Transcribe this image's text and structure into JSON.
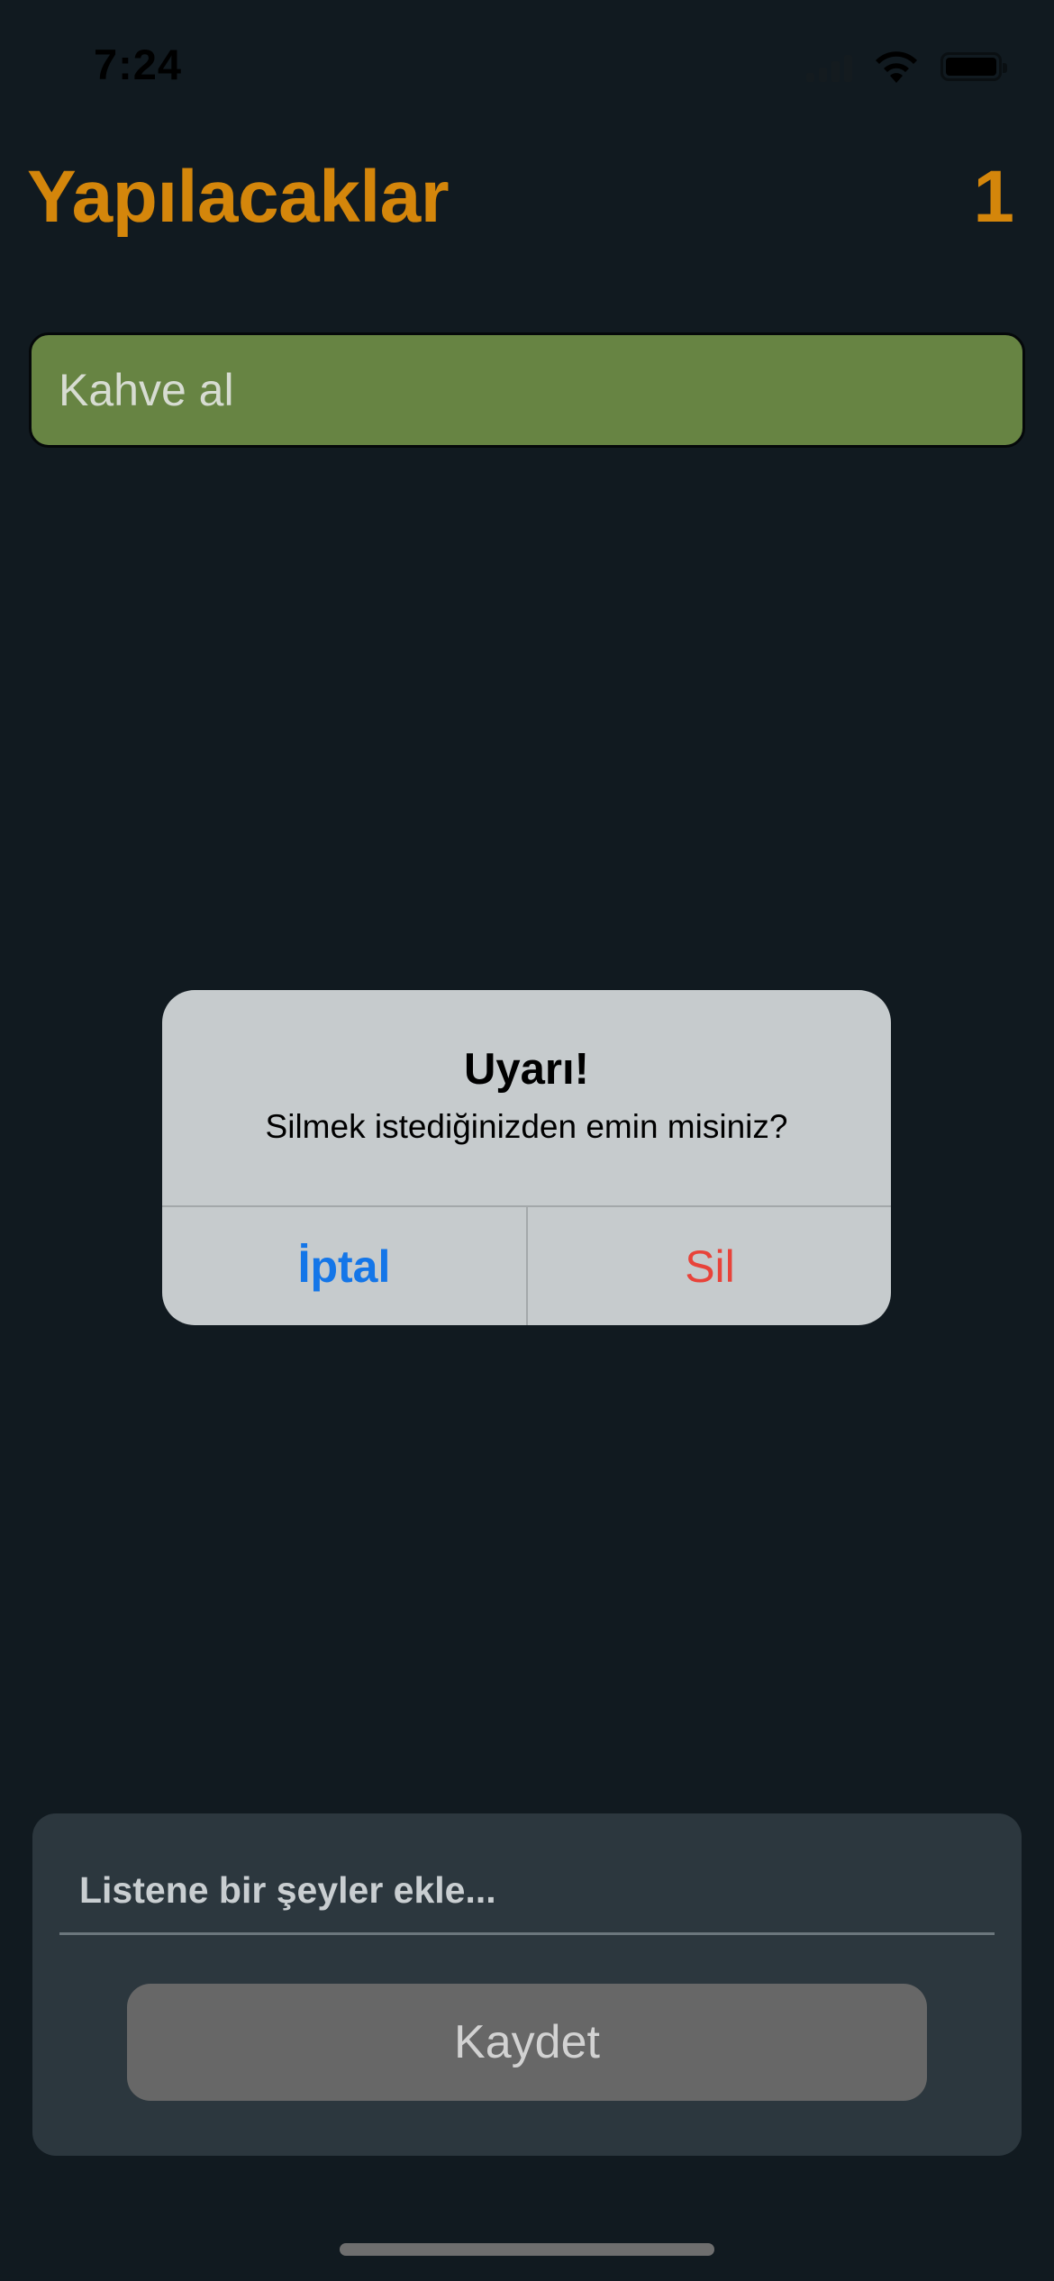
{
  "status_bar": {
    "time": "7:24"
  },
  "header": {
    "title": "Yapılacaklar",
    "count": "1"
  },
  "list": {
    "items": [
      {
        "text": "Kahve al",
        "color": "#678443"
      }
    ]
  },
  "alert": {
    "title": "Uyarı!",
    "message": "Silmek istediğinizden emin misiniz?",
    "cancel_label": "İptal",
    "delete_label": "Sil"
  },
  "input_panel": {
    "placeholder": "Listene bir şeyler ekle...",
    "value": "",
    "save_label": "Kaydet"
  },
  "colors": {
    "background": "#111a20",
    "accent": "#d4860b",
    "cancel": "#1476e8",
    "destructive": "#e8433a"
  }
}
